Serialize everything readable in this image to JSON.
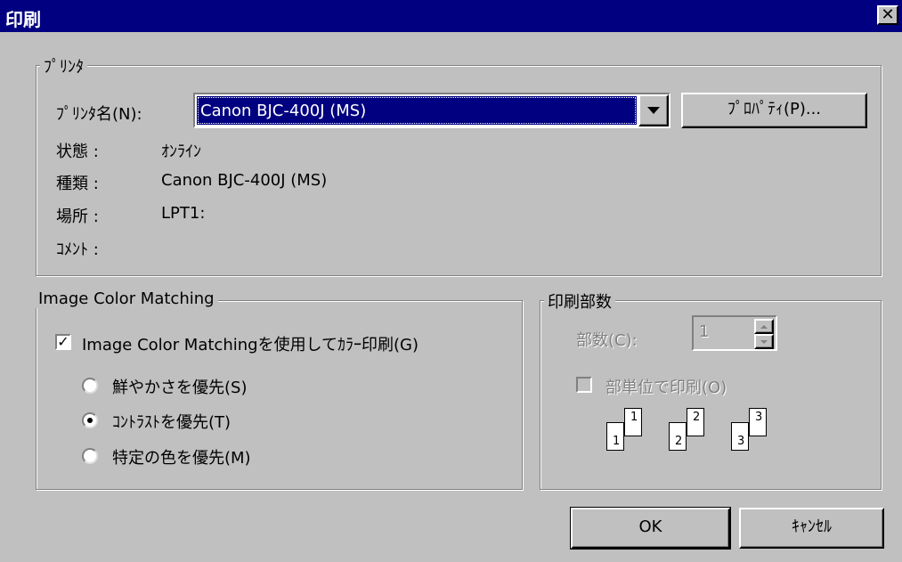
{
  "dialog": {
    "title": "印刷",
    "close_symbol": "✕"
  },
  "printer": {
    "group_label": "ﾌﾟﾘﾝﾀ",
    "name_label": "ﾌﾟﾘﾝﾀ名(N):",
    "selected_printer": "Canon BJC-400J (MS)",
    "properties_button": "ﾌﾟﾛﾊﾟﾃｨ(P)...",
    "status_label": "状態 :",
    "status_value": "ｵﾝﾗｲﾝ",
    "type_label": "種類 :",
    "type_value": "Canon BJC-400J (MS)",
    "location_label": "場所 :",
    "location_value": "LPT1:",
    "comment_label": "ｺﾒﾝﾄ :"
  },
  "icm": {
    "group_label": "Image Color Matching",
    "use_icm_label": "Image Color Matchingを使用してｶﾗｰ印刷(G)",
    "use_icm_checked": true,
    "options": [
      {
        "label": "鮮やかさを優先(S)",
        "selected": false
      },
      {
        "label": "ｺﾝﾄﾗｽﾄを優先(T)",
        "selected": true
      },
      {
        "label": "特定の色を優先(M)",
        "selected": false
      }
    ]
  },
  "copies": {
    "group_label": "印刷部数",
    "count_label": "部数(C):",
    "count_value": "1",
    "collate_label": "部単位で印刷(O)",
    "collate_checked": false,
    "collate_pages": [
      "1",
      "1",
      "2",
      "2",
      "3",
      "3"
    ]
  },
  "buttons": {
    "ok": "OK",
    "cancel": "ｷｬﾝｾﾙ"
  }
}
